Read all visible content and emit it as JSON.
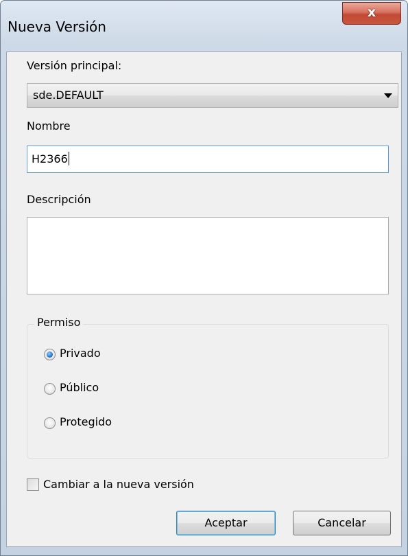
{
  "window": {
    "title": "Nueva Versión",
    "close_glyph": "x"
  },
  "parent_version": {
    "label": "Versión principal:",
    "selected": "sde.DEFAULT"
  },
  "name": {
    "label": "Nombre",
    "value": "H2366"
  },
  "description": {
    "label": "Descripción",
    "value": ""
  },
  "permission": {
    "legend": "Permiso",
    "options": [
      {
        "label": "Privado",
        "checked": true
      },
      {
        "label": "Público",
        "checked": false
      },
      {
        "label": "Protegido",
        "checked": false
      }
    ]
  },
  "switch_option": {
    "label": "Cambiar a la nueva versión",
    "checked": false
  },
  "buttons": {
    "accept": "Aceptar",
    "cancel": "Cancelar"
  },
  "icons": {
    "close": "close-icon",
    "dropdown": "chevron-down-icon"
  },
  "colors": {
    "focus_border": "#5b9bd5",
    "close_button": "#c24a35",
    "radio_dot": "#2b74c7"
  }
}
